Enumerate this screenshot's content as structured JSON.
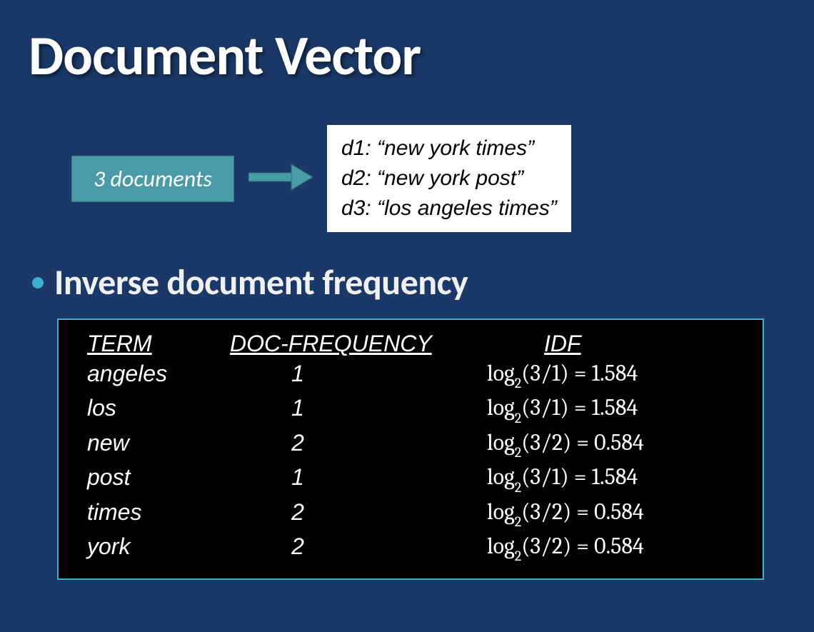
{
  "title": "Document Vector",
  "badge": "3 documents",
  "documents": [
    "d1: “new york times”",
    "d2: “new york post”",
    "d3: “los angeles times”"
  ],
  "bullet": "Inverse document frequency",
  "table": {
    "headers": {
      "term": "TERM",
      "df": "DOC-FREQUENCY",
      "idf": "IDF"
    },
    "rows": [
      {
        "term": "angeles",
        "df": "1",
        "idf_frac": "3/1",
        "idf_val": "1.584"
      },
      {
        "term": "los",
        "df": "1",
        "idf_frac": "3/1",
        "idf_val": "1.584"
      },
      {
        "term": "new",
        "df": "2",
        "idf_frac": "3/2",
        "idf_val": "0.584"
      },
      {
        "term": "post",
        "df": "1",
        "idf_frac": "3/1",
        "idf_val": "1.584"
      },
      {
        "term": "times",
        "df": "2",
        "idf_frac": "3/2",
        "idf_val": "0.584"
      },
      {
        "term": "york",
        "df": "2",
        "idf_frac": "3/2",
        "idf_val": "0.584"
      }
    ]
  }
}
